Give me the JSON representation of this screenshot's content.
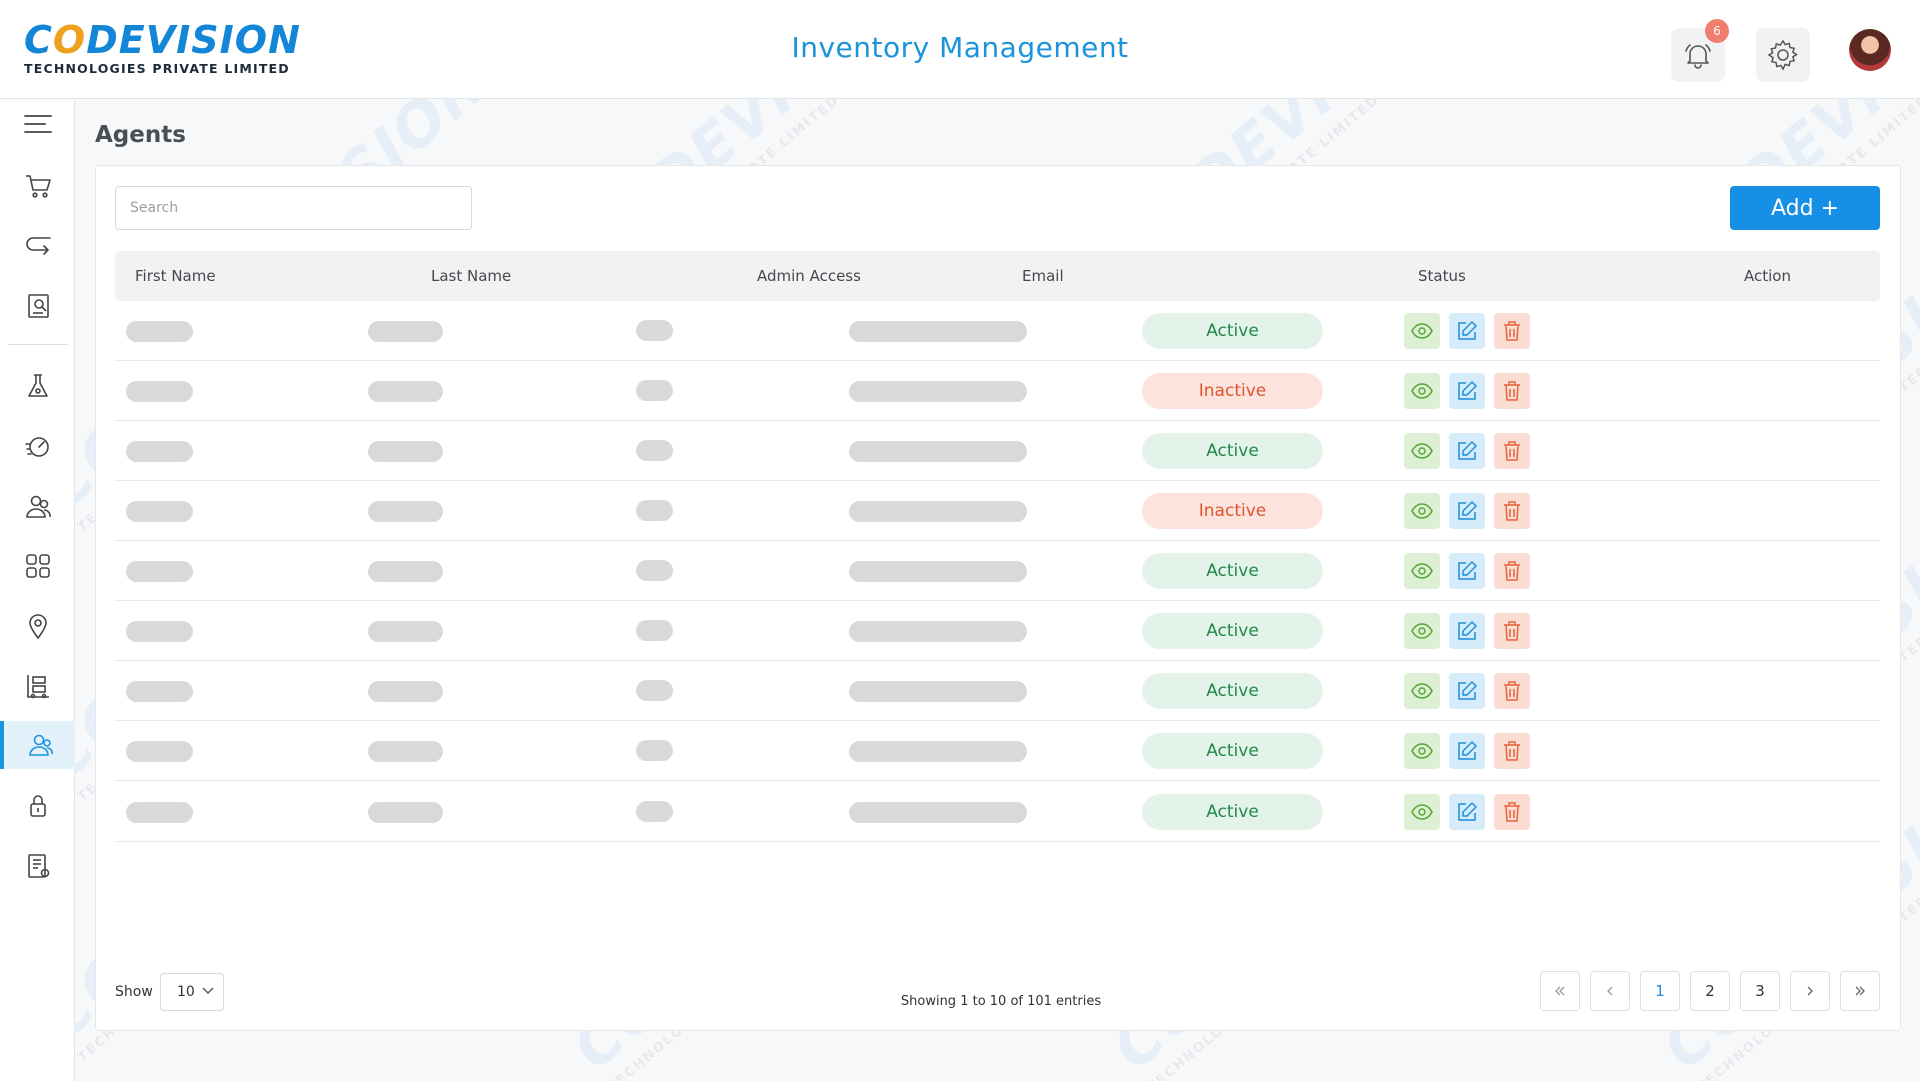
{
  "header": {
    "logo_main": "CODEVISION",
    "logo_sub": "TECHNOLOGIES PRIVATE LIMITED",
    "app_title": "Inventory Management",
    "notification_count": "6"
  },
  "sidebar": {
    "items": [
      {
        "icon": "menu-icon"
      },
      {
        "icon": "cart-icon"
      },
      {
        "icon": "return-icon"
      },
      {
        "icon": "report-icon"
      },
      {
        "icon": "lab-icon"
      },
      {
        "icon": "dashboard-speed-icon"
      },
      {
        "icon": "users-icon"
      },
      {
        "icon": "grid-icon"
      },
      {
        "icon": "location-pin-icon"
      },
      {
        "icon": "warehouse-icon"
      },
      {
        "icon": "agents-icon",
        "active": true
      },
      {
        "icon": "lock-icon"
      },
      {
        "icon": "document-list-icon"
      }
    ]
  },
  "page": {
    "title": "Agents",
    "search_placeholder": "Search",
    "add_label": "Add +"
  },
  "table": {
    "columns": [
      "First Name",
      "Last Name",
      "Admin Access",
      "Email",
      "Status",
      "Action"
    ],
    "rows": [
      {
        "status": "Active"
      },
      {
        "status": "Inactive"
      },
      {
        "status": "Active"
      },
      {
        "status": "Inactive"
      },
      {
        "status": "Active"
      },
      {
        "status": "Active"
      },
      {
        "status": "Active"
      },
      {
        "status": "Active"
      },
      {
        "status": "Active"
      }
    ]
  },
  "footer": {
    "show_label": "Show",
    "page_size": "10",
    "entries_text": "Showing 1 to 10  of 101 entries",
    "pages": [
      "1",
      "2",
      "3"
    ],
    "current_page": "1"
  },
  "colors": {
    "accent": "#1b94db",
    "button": "#1690e6",
    "active_text": "#1f8a45",
    "inactive_text": "#e0552c"
  }
}
